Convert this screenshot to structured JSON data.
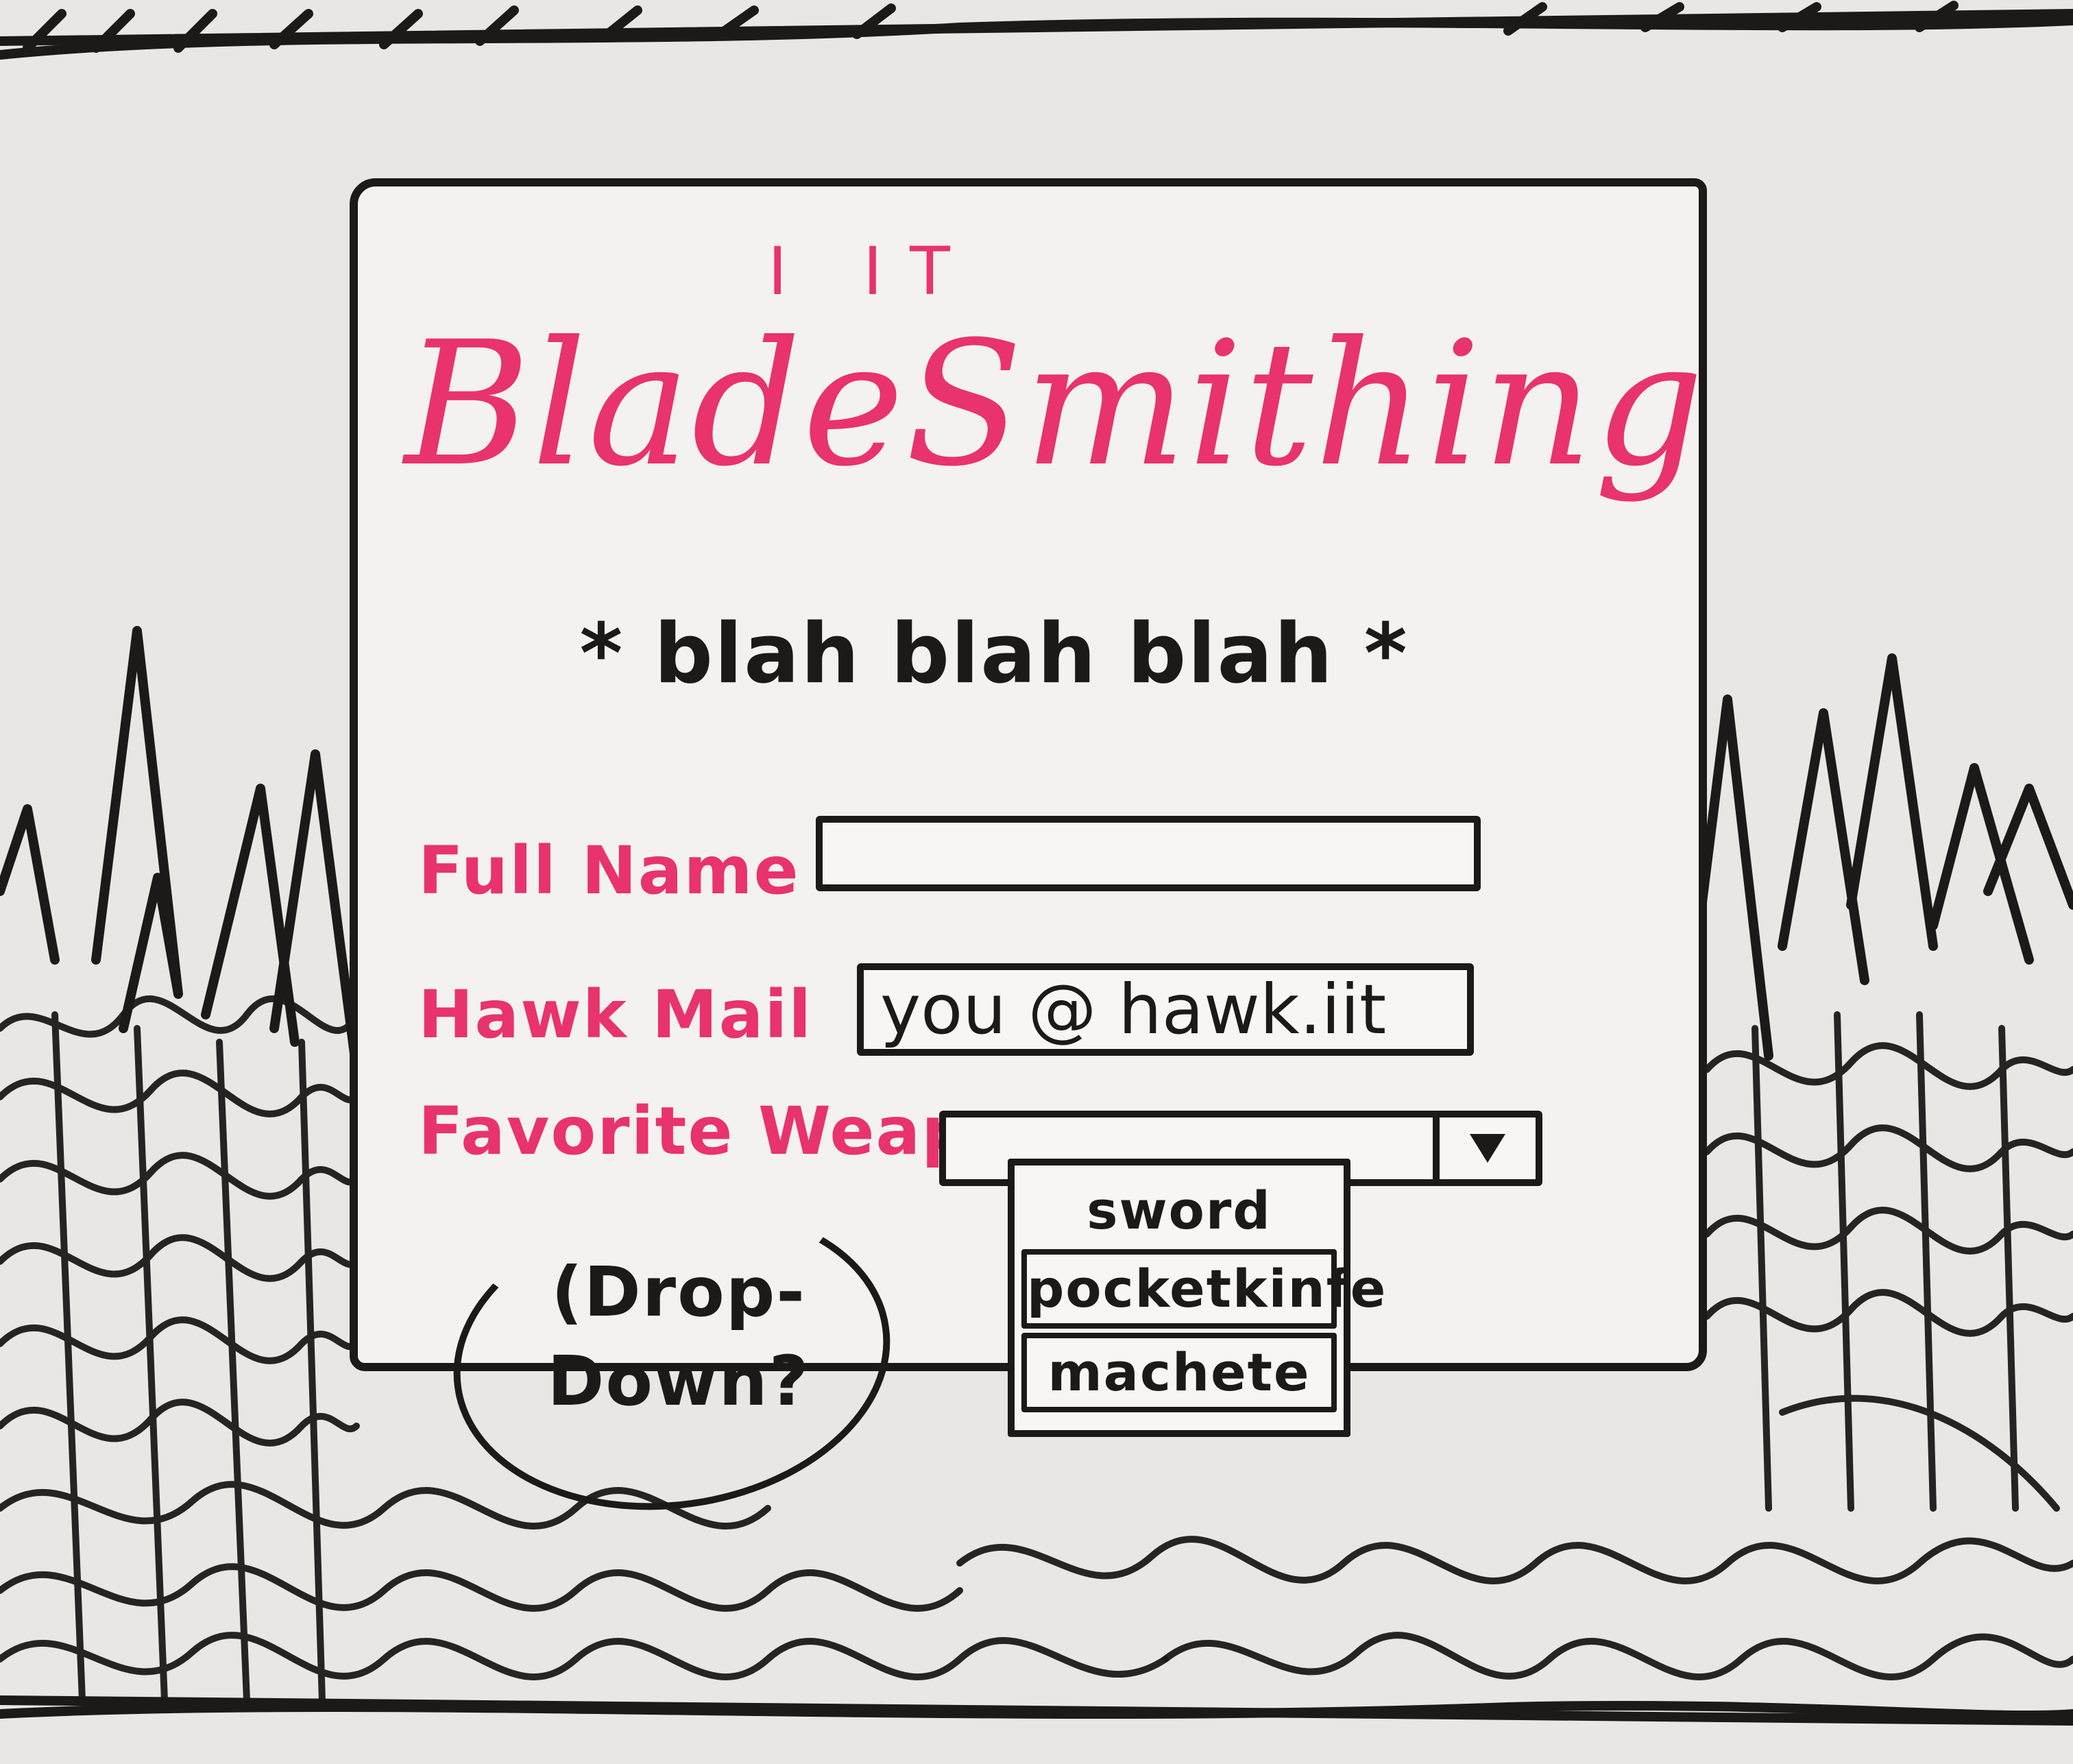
{
  "header": {
    "org_label": "I IT",
    "site_title": "BladeSmithing",
    "tagline": "* blah blah blah *"
  },
  "form": {
    "fullname": {
      "label": "Full Name",
      "value": ""
    },
    "hawkmail": {
      "label": "Hawk Mail",
      "placeholder": "you @ hawk.iit"
    },
    "weapon": {
      "label": "Favorite Weapon",
      "selected": "",
      "options": [
        "sword",
        "pocketkinfe",
        "machete"
      ]
    }
  },
  "annotation": {
    "note": "(Drop-\nDown?"
  },
  "colors": {
    "pink_marker": "#e8336d",
    "black_marker": "#1b1a18",
    "board": "#e9e7e4"
  },
  "icons": {
    "dropdown_arrow": "triangle-down-icon"
  }
}
